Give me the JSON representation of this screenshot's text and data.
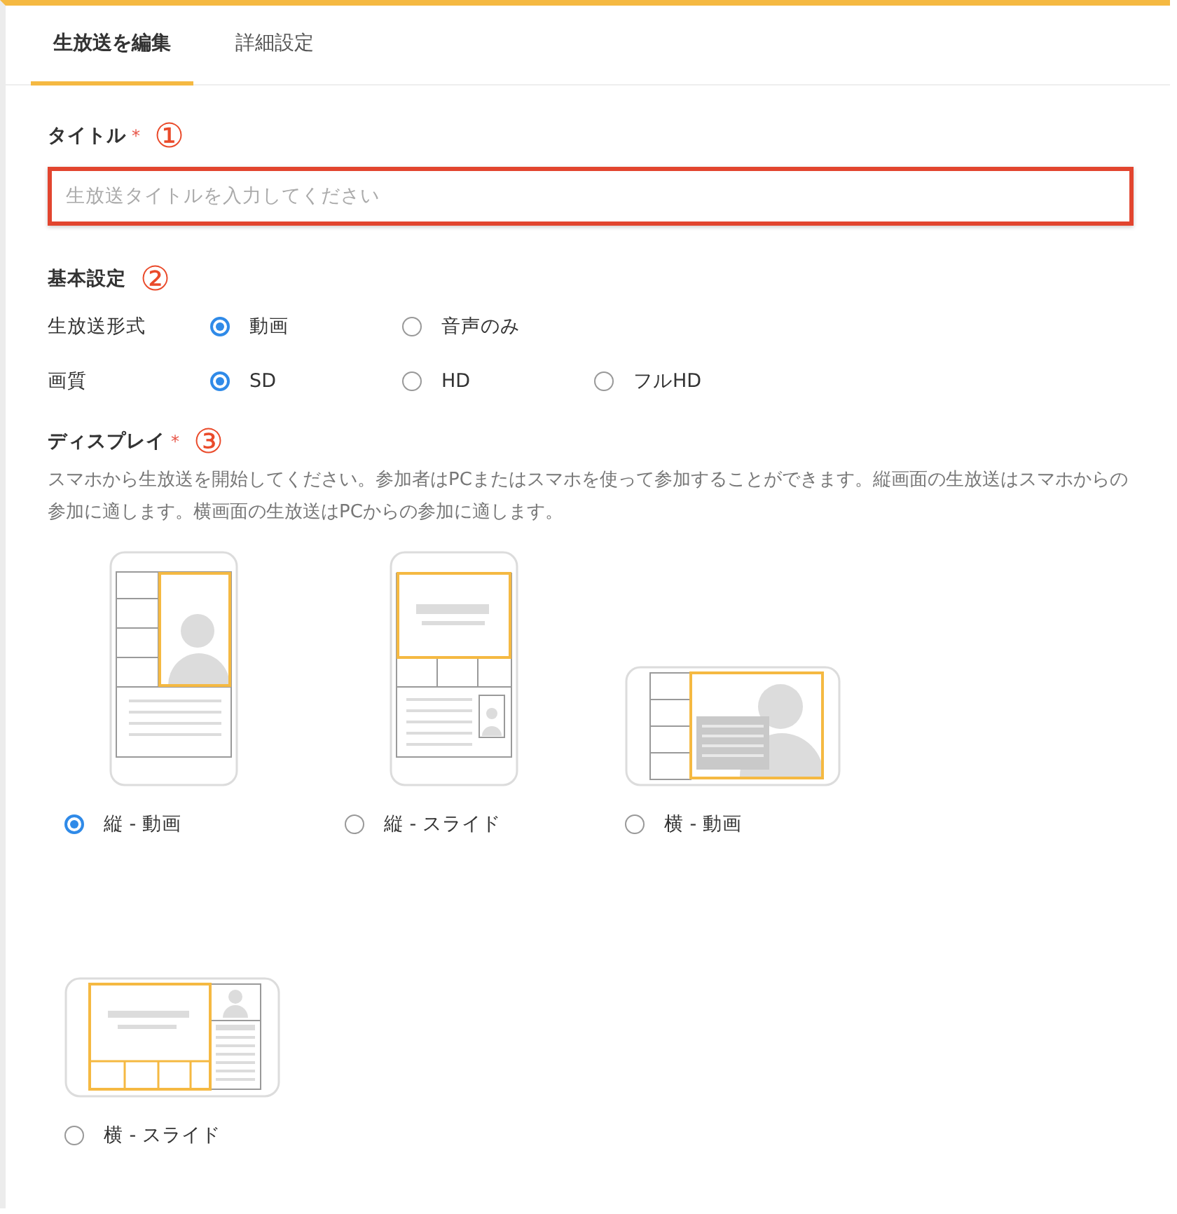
{
  "tabs": [
    {
      "label": "生放送を編集",
      "selected": true
    },
    {
      "label": "詳細設定",
      "selected": false
    }
  ],
  "title_field": {
    "label": "タイトル",
    "required_mark": "*",
    "annotation": "①",
    "placeholder": "生放送タイトルを入力してください"
  },
  "basic_settings": {
    "heading": "基本設定",
    "annotation": "②",
    "rows": [
      {
        "label": "生放送形式",
        "options": [
          {
            "label": "動画",
            "selected": true
          },
          {
            "label": "音声のみ",
            "selected": false
          }
        ]
      },
      {
        "label": "画質",
        "options": [
          {
            "label": "SD",
            "selected": true
          },
          {
            "label": "HD",
            "selected": false
          },
          {
            "label": "フルHD",
            "selected": false
          }
        ]
      }
    ]
  },
  "display": {
    "heading": "ディスプレイ",
    "required_mark": "*",
    "annotation": "③",
    "description": "スマホから生放送を開始してください。参加者はPCまたはスマホを使って参加することができます。縦画面の生放送はスマホからの参加に適します。横画面の生放送はPCからの参加に適します。",
    "options": [
      {
        "label": "縦 - 動画",
        "kind": "portrait-video",
        "selected": true
      },
      {
        "label": "縦 - スライド",
        "kind": "portrait-slide",
        "selected": false
      },
      {
        "label": "横 - 動画",
        "kind": "landscape-video",
        "selected": false
      },
      {
        "label": "横 - スライド",
        "kind": "landscape-slide",
        "selected": false
      }
    ]
  }
}
